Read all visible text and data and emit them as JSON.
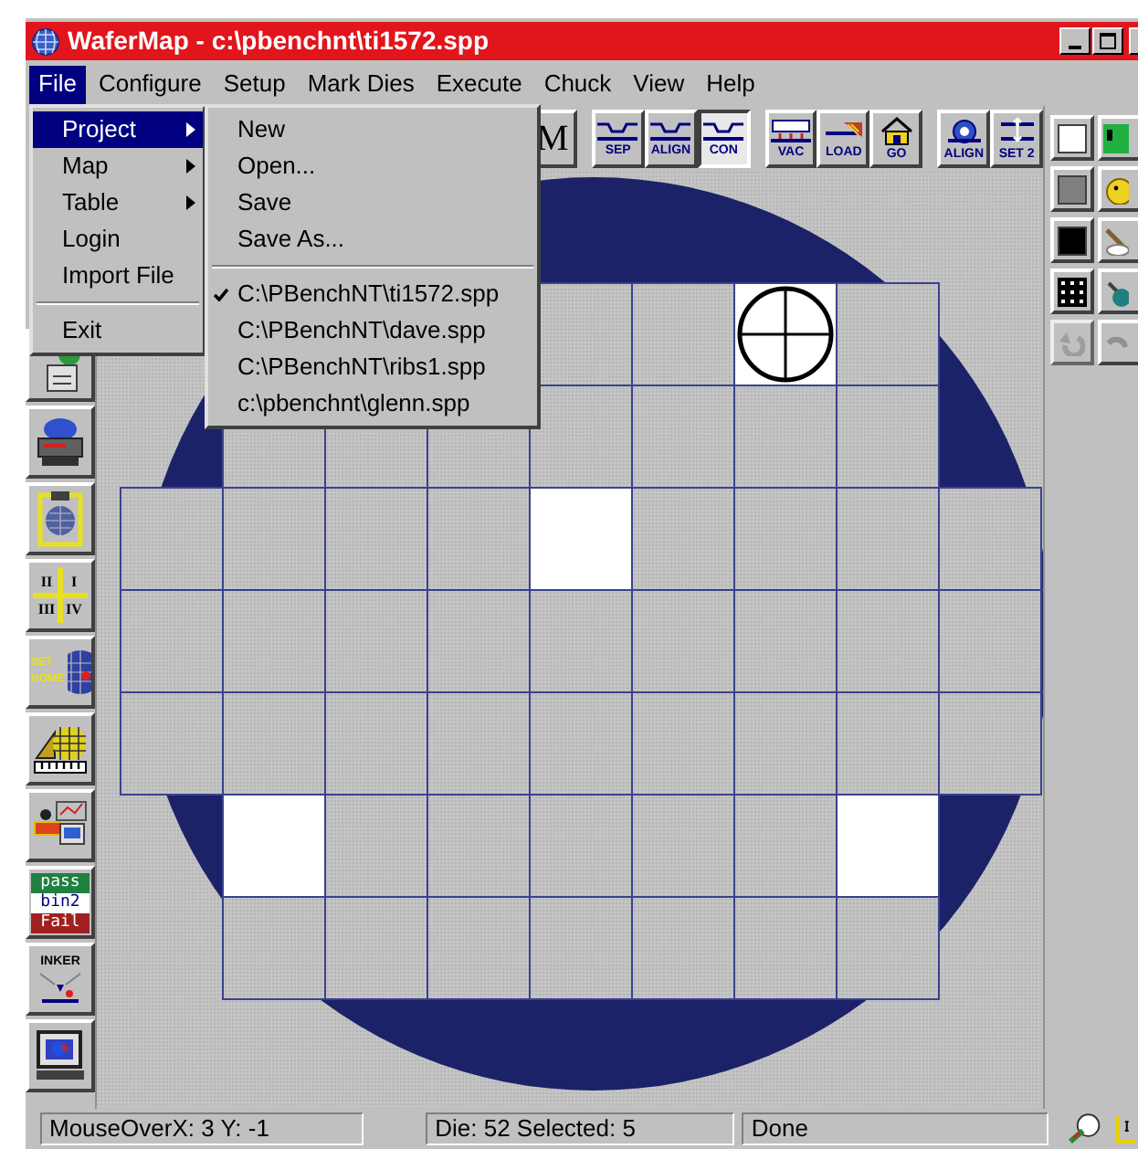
{
  "window": {
    "title": "WaferMap - c:\\pbenchnt\\ti1572.spp"
  },
  "menu_bar": [
    {
      "label": "File",
      "selected": true
    },
    {
      "label": "Configure",
      "selected": false
    },
    {
      "label": "Setup",
      "selected": false
    },
    {
      "label": "Mark Dies",
      "selected": false
    },
    {
      "label": "Execute",
      "selected": false
    },
    {
      "label": "Chuck",
      "selected": false
    },
    {
      "label": "View",
      "selected": false
    },
    {
      "label": "Help",
      "selected": false
    }
  ],
  "file_menu": {
    "groups": [
      [
        {
          "label": "Project",
          "submenu": true,
          "selected": true
        },
        {
          "label": "Map",
          "submenu": true,
          "selected": false
        },
        {
          "label": "Table",
          "submenu": true,
          "selected": false
        },
        {
          "label": "Login",
          "submenu": false,
          "selected": false
        },
        {
          "label": "Import File",
          "submenu": false,
          "selected": false
        }
      ],
      [
        {
          "label": "Exit",
          "submenu": false,
          "selected": false
        }
      ]
    ]
  },
  "project_submenu": {
    "commands": [
      {
        "label": "New"
      },
      {
        "label": "Open..."
      },
      {
        "label": "Save"
      },
      {
        "label": "Save As..."
      }
    ],
    "recent_files": [
      {
        "label": "C:\\PBenchNT\\ti1572.spp",
        "checked": true
      },
      {
        "label": "C:\\PBenchNT\\dave.spp",
        "checked": false
      },
      {
        "label": "C:\\PBenchNT\\ribs1.spp",
        "checked": false
      },
      {
        "label": "c:\\pbenchnt\\glenn.spp",
        "checked": false
      }
    ]
  },
  "toolbar": [
    {
      "kind": "text",
      "label": "M",
      "pressed": false,
      "gap_before": false
    },
    {
      "kind": "chuck",
      "label": "SEP",
      "pressed": false,
      "gap_before": true
    },
    {
      "kind": "chuck",
      "label": "ALIGN",
      "pressed": false,
      "gap_before": false
    },
    {
      "kind": "chuck",
      "label": "CON",
      "pressed": true,
      "gap_before": false
    },
    {
      "kind": "vacuum",
      "label": "VAC",
      "pressed": false,
      "gap_before": true
    },
    {
      "kind": "load",
      "label": "LOAD",
      "pressed": false,
      "gap_before": false
    },
    {
      "kind": "home",
      "label": "GO",
      "pressed": false,
      "gap_before": false
    },
    {
      "kind": "target",
      "label": "ALIGN",
      "pressed": false,
      "gap_before": true
    },
    {
      "kind": "height",
      "label": "SET 2",
      "pressed": false,
      "gap_before": false
    }
  ],
  "left_toolbar": [
    {
      "kind": "map-printer"
    },
    {
      "kind": "printer"
    },
    {
      "kind": "clipboard"
    },
    {
      "kind": "quadrants",
      "labels": [
        "II",
        "I",
        "III",
        "IV"
      ]
    },
    {
      "kind": "set-home",
      "labels": [
        "SET",
        "HOME"
      ]
    },
    {
      "kind": "ruler-map"
    },
    {
      "kind": "operator"
    },
    {
      "kind": "bins",
      "labels": [
        "pass",
        "bin2",
        "Fail"
      ]
    },
    {
      "kind": "inker",
      "labels": [
        "INKER"
      ]
    },
    {
      "kind": "monitor"
    }
  ],
  "right_toolbar": [
    {
      "kind": "swatch",
      "color": "#ffffff"
    },
    {
      "kind": "swatch",
      "color": "#808080"
    },
    {
      "kind": "swatch",
      "color": "#000000"
    },
    {
      "kind": "pattern"
    },
    {
      "kind": "undo",
      "disabled": true
    }
  ],
  "status_bar": {
    "mouse_over": "MouseOverX:  3 Y: -1",
    "die": "Die:  52   Selected:   5",
    "status": "Done"
  }
}
